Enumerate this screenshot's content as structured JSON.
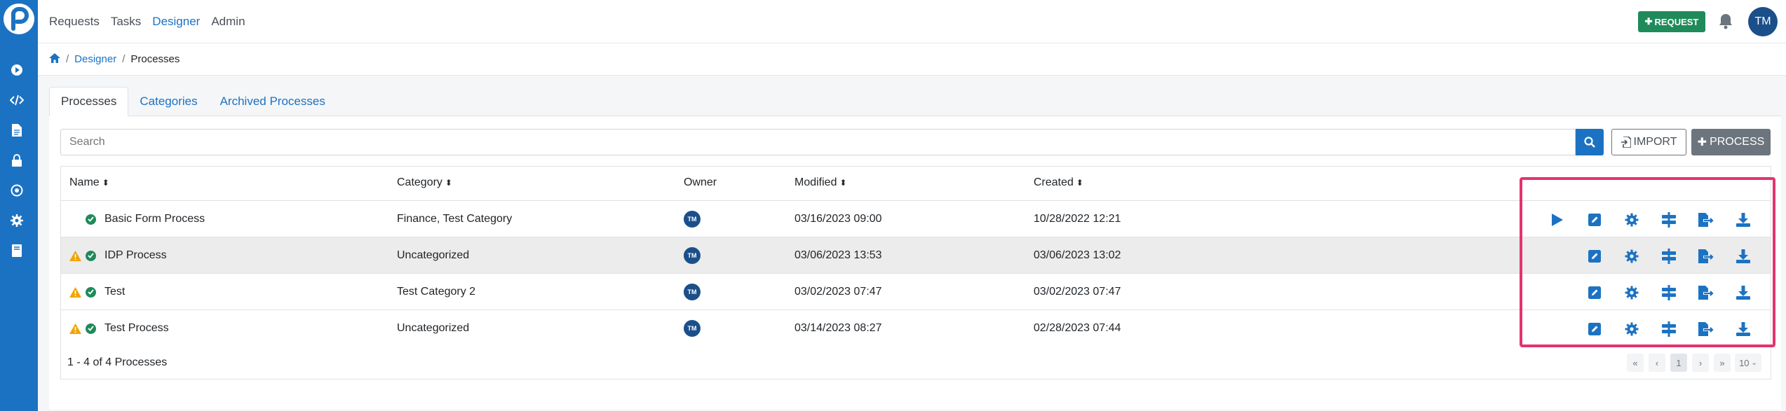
{
  "topnav": {
    "items": [
      "Requests",
      "Tasks",
      "Designer",
      "Admin"
    ],
    "request_label": "REQUEST",
    "avatar": "TM"
  },
  "breadcrumb": {
    "designer": "Designer",
    "current": "Processes"
  },
  "tabs": [
    "Processes",
    "Categories",
    "Archived Processes"
  ],
  "search": {
    "placeholder": "Search"
  },
  "buttons": {
    "import": "IMPORT",
    "process": "PROCESS"
  },
  "table": {
    "headers": {
      "name": "Name",
      "category": "Category",
      "owner": "Owner",
      "modified": "Modified",
      "created": "Created"
    },
    "rows": [
      {
        "name": "Basic Form Process",
        "category": "Finance, Test Category",
        "owner": "TM",
        "modified": "03/16/2023 09:00",
        "created": "10/28/2022 12:21"
      },
      {
        "name": "IDP Process",
        "category": "Uncategorized",
        "owner": "TM",
        "modified": "03/06/2023 13:53",
        "created": "03/06/2023 13:02"
      },
      {
        "name": "Test",
        "category": "Test Category 2",
        "owner": "TM",
        "modified": "03/02/2023 07:47",
        "created": "03/02/2023 07:47"
      },
      {
        "name": "Test Process",
        "category": "Uncategorized",
        "owner": "TM",
        "modified": "03/14/2023 08:27",
        "created": "02/28/2023 07:44"
      }
    ]
  },
  "footer": {
    "count": "1 - 4 of 4 Processes",
    "page": "1",
    "per_page": "10"
  },
  "colors": {
    "primary": "#1c72c2",
    "success": "#1f8a5a",
    "warning": "#f0a500",
    "highlight": "#e4336d"
  }
}
